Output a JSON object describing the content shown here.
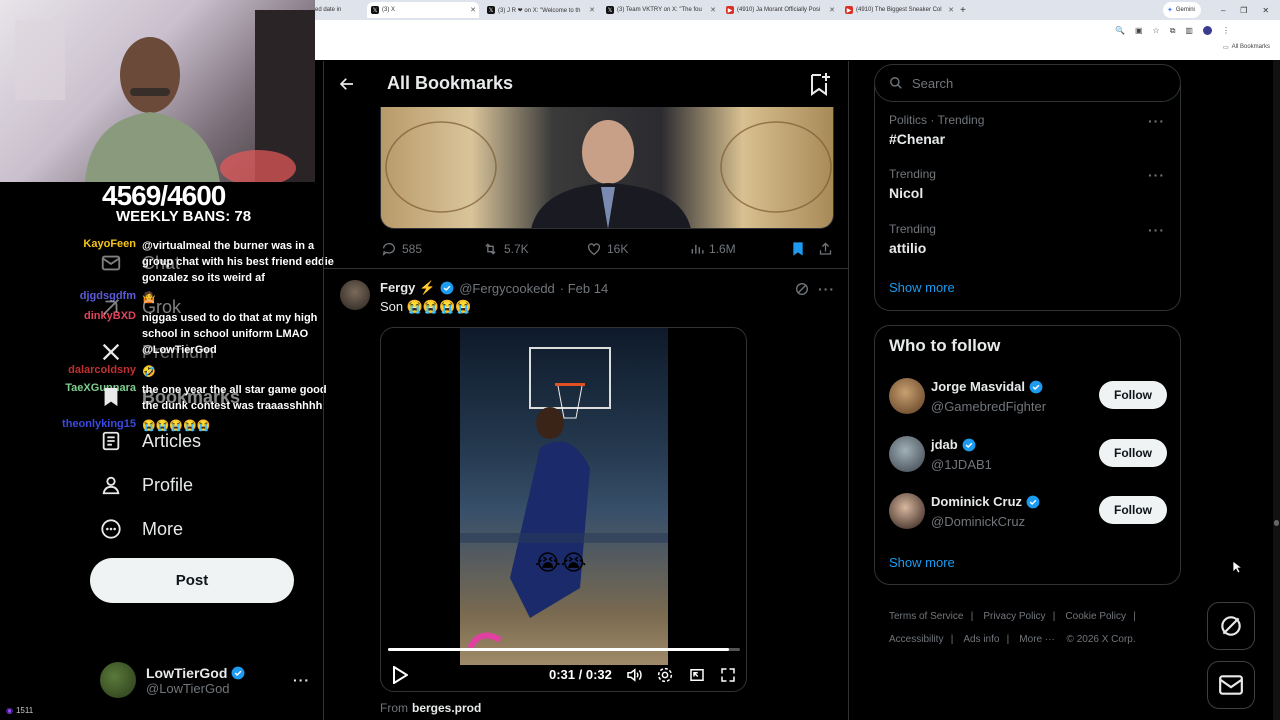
{
  "browser": {
    "tabs": [
      {
        "label": "ed date in",
        "icon": "x"
      },
      {
        "label": "(3) X",
        "icon": "x",
        "active": true
      },
      {
        "label": "(3) J R ❤ on X: \"Welcome to th",
        "icon": "x"
      },
      {
        "label": "(3) Team VKTRY on X: \"The fou",
        "icon": "x"
      },
      {
        "label": "(4910) Ja Morant Officially Posi",
        "icon": "youtube"
      },
      {
        "label": "(4910) The Biggest Sneaker Col",
        "icon": "youtube"
      }
    ],
    "new_tab": "+",
    "gemini_label": "Gemini",
    "bookmarks_label": "All Bookmarks"
  },
  "stream": {
    "sub_count": "4569/4600",
    "weekly_label": "WEEKLY BANS: 78",
    "chat": [
      {
        "user": "KayoFeen",
        "user_color": "#f5c518",
        "message": "@virtualmeal the burner was in a group chat with his best friend eddie gonzalez so its weird af"
      },
      {
        "user": "djgdsgdfm",
        "user_color": "#5b5bd6",
        "message": "🤷"
      },
      {
        "user": "dinkyBXD",
        "user_color": "#e0445a",
        "message": "niggas used to do that at my high school in school uniform LMAO @LowTierGod"
      },
      {
        "user": "dalarcoldsny",
        "user_color": "#c03030",
        "message": "🤣"
      },
      {
        "user": "TaeXGunnara",
        "user_color": "#7ecf8f",
        "message": "the one year the all star game good the dunk contest was traaasshhhh"
      },
      {
        "user": "theonlyking15",
        "user_color": "#3a4ae0",
        "message": "😭😭😭😭😭"
      }
    ],
    "viewer_count": "1511"
  },
  "nav": {
    "items": [
      {
        "label": "Chat",
        "icon": "envelope-icon"
      },
      {
        "label": "Grok",
        "icon": "grok-icon"
      },
      {
        "label": "Premium",
        "icon": "x-logo-icon"
      },
      {
        "label": "Bookmarks",
        "icon": "bookmark-icon"
      },
      {
        "label": "Articles",
        "icon": "article-icon"
      },
      {
        "label": "Profile",
        "icon": "person-icon"
      },
      {
        "label": "More",
        "icon": "more-circle-icon"
      }
    ],
    "post_label": "Post",
    "account": {
      "name": "LowTierGod",
      "handle": "@LowTierGod"
    }
  },
  "main": {
    "title": "All Bookmarks",
    "first_post": {
      "replies": "585",
      "reposts": "5.7K",
      "likes": "16K",
      "views": "1.6M"
    },
    "second_post": {
      "author": "Fergy ⚡",
      "handle": "@Fergycookedd",
      "date": "· Feb 14",
      "text": "Son 😭😭😭😭",
      "video_time": "0:31 / 0:32",
      "video_progress": 0.97,
      "from_label": "From",
      "from_source": "berges.prod"
    }
  },
  "sidebar": {
    "search_placeholder": "Search",
    "trends": [
      {
        "category": "Politics · Trending",
        "name": "#Chenar"
      },
      {
        "category": "Trending",
        "name": "Nicol"
      },
      {
        "category": "Trending",
        "name": "attilio"
      }
    ],
    "show_more": "Show more",
    "who_to_follow_title": "Who to follow",
    "follow_suggestions": [
      {
        "name": "Jorge Masvidal",
        "handle": "@GamebredFighter",
        "button": "Follow"
      },
      {
        "name": "jdab",
        "handle": "@1JDAB1",
        "button": "Follow"
      },
      {
        "name": "Dominick Cruz",
        "handle": "@DominickCruz",
        "button": "Follow"
      }
    ],
    "show_more_follow": "Show more",
    "footer": [
      "Terms of Service",
      "Privacy Policy",
      "Cookie Policy",
      "Accessibility",
      "Ads info",
      "More ···",
      "© 2026 X Corp."
    ]
  },
  "colors": {
    "accent": "#1d9bf0",
    "verified": "#1d9bf0",
    "background": "#000000",
    "border": "#2f3336",
    "muted": "#71767b"
  }
}
